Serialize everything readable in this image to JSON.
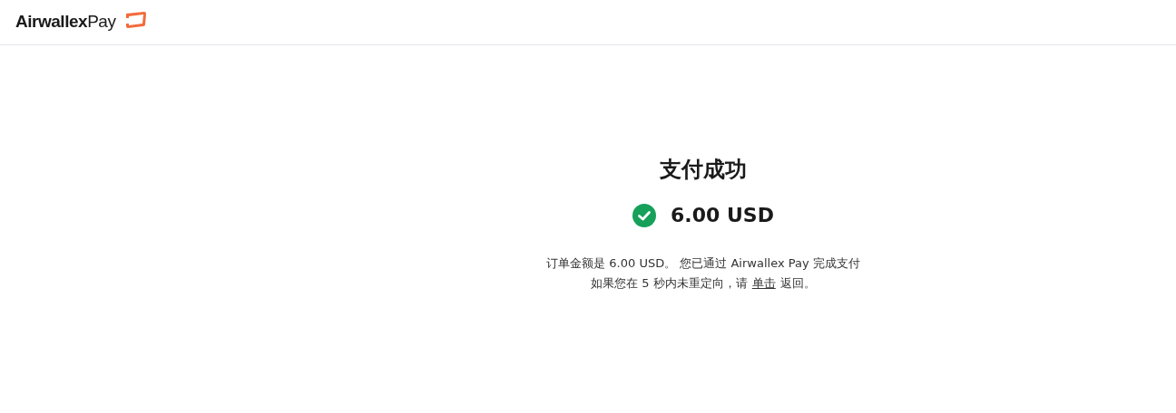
{
  "header": {
    "logo": "**Airwallex**Pay"
  },
  "result": {
    "title": "支付成功",
    "succeeded": true,
    "amount": "6.00 USD",
    "message": "订单金额是 6.00 USD。 您已通过 Airwallex Pay 完成支付",
    "redirect_before": "如果您在 5 秒内未重定向，请",
    "redirect_link": "单击",
    "redirect_after": "返回。"
  }
}
